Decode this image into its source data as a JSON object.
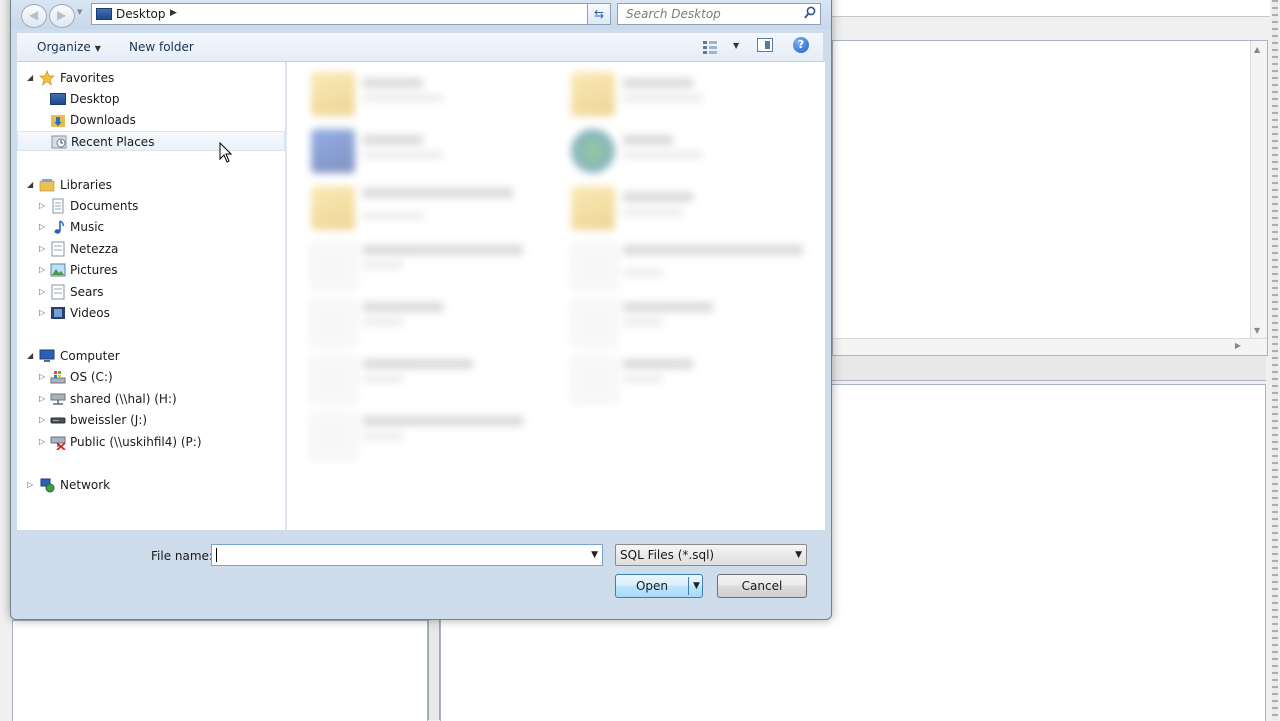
{
  "address_bar": {
    "location": "Desktop"
  },
  "search": {
    "placeholder": "Search Desktop"
  },
  "toolbar": {
    "organize_label": "Organize",
    "new_folder_label": "New folder",
    "help_label": "?"
  },
  "nav_pane": {
    "favorites": {
      "label": "Favorites",
      "items": [
        "Desktop",
        "Downloads",
        "Recent Places"
      ]
    },
    "libraries": {
      "label": "Libraries",
      "items": [
        "Documents",
        "Music",
        "Netezza",
        "Pictures",
        "Sears",
        "Videos"
      ]
    },
    "computer": {
      "label": "Computer",
      "items": [
        "OS (C:)",
        "shared (\\\\hal) (H:)",
        "bweissler (J:)",
        "Public (\\\\uskihfil4) (P:)"
      ]
    },
    "network": {
      "label": "Network"
    }
  },
  "footer": {
    "file_name_label": "File name:",
    "file_name_value": "",
    "file_type": "SQL Files (*.sql)",
    "open_label": "Open",
    "cancel_label": "Cancel"
  },
  "colors": {
    "dialog_frame": "#cfdcec",
    "open_button_border": "#3c7fb1",
    "selection_hover": "#eaf1f9"
  }
}
